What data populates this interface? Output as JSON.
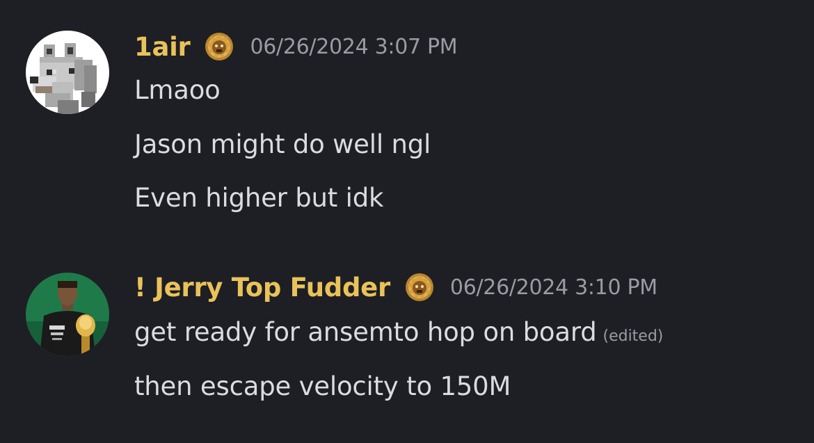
{
  "colors": {
    "background": "#1e1f24",
    "username": "#e9c25a",
    "message_text": "#dbdce1",
    "timestamp": "#9a9ca5"
  },
  "messages": [
    {
      "author": "1air",
      "avatar_icon": "wolf-avatar-icon",
      "badge_icon": "lion-badge-icon",
      "timestamp": "06/26/2024 3:07 PM",
      "lines": [
        {
          "text": "Lmaoo"
        },
        {
          "text": "Jason might do well ngl"
        },
        {
          "text": "Even higher but idk"
        }
      ]
    },
    {
      "author": "! Jerry Top Fudder",
      "avatar_icon": "player-photo-avatar-icon",
      "badge_icon": "lion-badge-icon",
      "timestamp": "06/26/2024 3:10 PM",
      "lines": [
        {
          "text": "get ready for ansemto hop on board",
          "edited": "(edited)"
        },
        {
          "text": "then escape velocity to 150M"
        }
      ]
    }
  ]
}
